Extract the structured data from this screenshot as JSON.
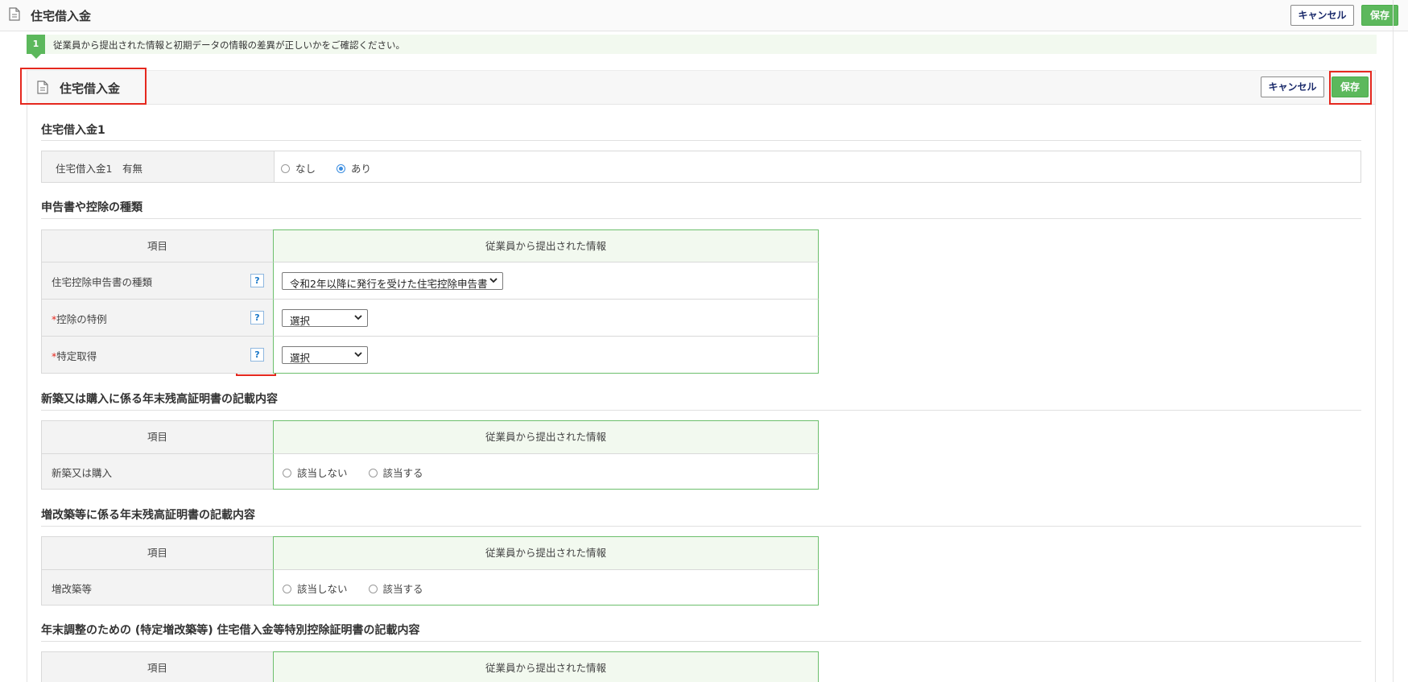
{
  "topbar": {
    "title": "住宅借入金",
    "cancel_label": "キャンセル",
    "save_label": "保存"
  },
  "notice": {
    "step": "1",
    "text": "従業員から提出された情報と初期データの情報の差異が正しいかをご確認ください。"
  },
  "panel": {
    "title": "住宅借入金",
    "cancel_label": "キャンセル",
    "save_label": "保存"
  },
  "loan1": {
    "section_title": "住宅借入金1",
    "row_label": "住宅借入金1　有無",
    "options": [
      "なし",
      "あり"
    ],
    "selected": "あり"
  },
  "deduction_type": {
    "section_title": "申告書や控除の種類",
    "header_item": "項目",
    "header_info": "従業員から提出された情報",
    "rows": [
      {
        "label": "住宅控除申告書の種類",
        "required": false,
        "help": "?",
        "value": "令和2年以降に発行を受けた住宅控除申告書"
      },
      {
        "label": "控除の特例",
        "required": true,
        "required_mark": "*",
        "help": "?",
        "value": "選択"
      },
      {
        "label": "特定取得",
        "required": true,
        "required_mark": "*",
        "help": "?",
        "value": "選択"
      }
    ]
  },
  "new_purchase": {
    "section_title": "新築又は購入に係る年末残高証明書の記載内容",
    "header_item": "項目",
    "header_info": "従業員から提出された情報",
    "row_label": "新築又は購入",
    "options": [
      "該当しない",
      "該当する"
    ]
  },
  "renovation": {
    "section_title": "増改築等に係る年末残高証明書の記載内容",
    "header_item": "項目",
    "header_info": "従業員から提出された情報",
    "row_label": "増改築等",
    "options": [
      "該当しない",
      "該当する"
    ]
  },
  "special_cert": {
    "section_title": "年末調整のための (特定増改築等) 住宅借入金等特別控除証明書の記載内容",
    "header_item": "項目",
    "header_info": "従業員から提出された情報"
  },
  "colors": {
    "accent_green": "#5cb85c",
    "highlight_red": "#e5281e",
    "radio_blue": "#3b8de0",
    "info_border": "#6cbf6c"
  }
}
